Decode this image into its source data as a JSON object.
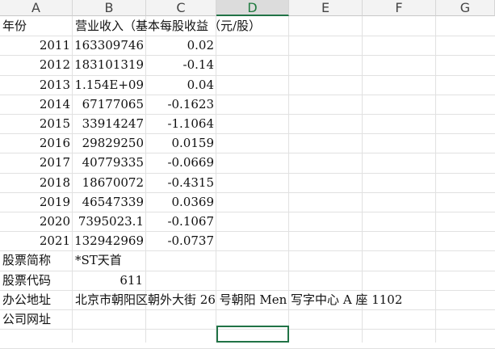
{
  "columns": [
    "A",
    "B",
    "C",
    "D",
    "E",
    "F",
    "G"
  ],
  "active_column": "D",
  "header_row": [
    "年份",
    "营业收入（基本每股收益（元/股）"
  ],
  "data_rows": [
    {
      "year": "2011",
      "revenue": "163309746",
      "eps": "0.02"
    },
    {
      "year": "2012",
      "revenue": "183101319",
      "eps": "-0.14"
    },
    {
      "year": "2013",
      "revenue": "1.154E+09",
      "eps": "0.04"
    },
    {
      "year": "2014",
      "revenue": "67177065",
      "eps": "-0.1623"
    },
    {
      "year": "2015",
      "revenue": "33914247",
      "eps": "-1.1064"
    },
    {
      "year": "2016",
      "revenue": "29829250",
      "eps": "0.0159"
    },
    {
      "year": "2017",
      "revenue": "40779335",
      "eps": "-0.0669"
    },
    {
      "year": "2018",
      "revenue": "18670072",
      "eps": "-0.4315"
    },
    {
      "year": "2019",
      "revenue": "46547339",
      "eps": "0.0369"
    },
    {
      "year": "2020",
      "revenue": "7395023.1",
      "eps": "-0.1067"
    },
    {
      "year": "2021",
      "revenue": "132942969",
      "eps": "-0.0737"
    }
  ],
  "info_rows": [
    {
      "label": "股票简称",
      "value": "*ST天首",
      "align": "left"
    },
    {
      "label": "股票代码",
      "value": "611",
      "align": "right"
    },
    {
      "label": "办公地址",
      "value": "北京市朝阳区朝外大街 26 号朝阳 Men 写字中心 A 座 1102",
      "align": "left"
    },
    {
      "label": "公司网址",
      "value": "",
      "align": "left"
    }
  ]
}
